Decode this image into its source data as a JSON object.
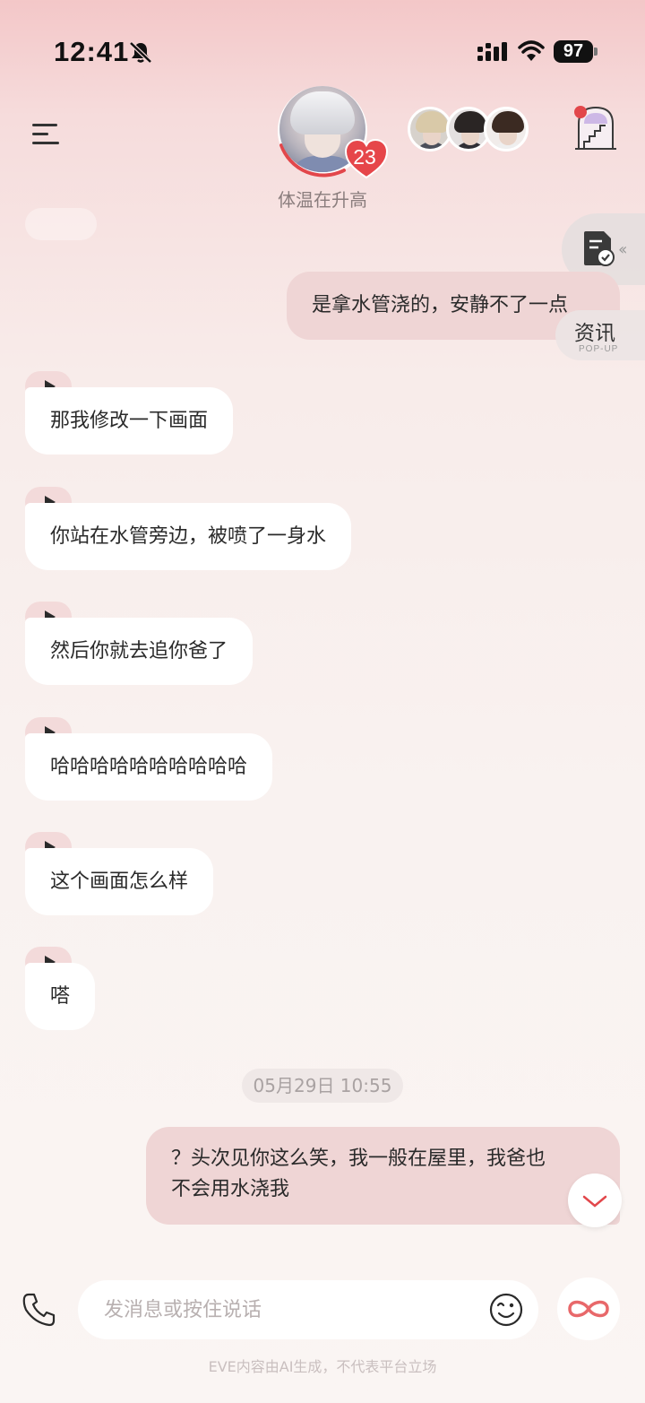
{
  "status_bar": {
    "time": "12:41",
    "battery": "97"
  },
  "header": {
    "affection_level": "23",
    "status_caption": "体温在升高"
  },
  "side_panel": {
    "news_label": "资讯",
    "news_sublabel": "POP-UP"
  },
  "messages": [
    {
      "role": "user",
      "text": "是拿水管浇的，安静不了一点"
    },
    {
      "role": "ai",
      "text": "那我修改一下画面"
    },
    {
      "role": "ai",
      "text": "你站在水管旁边，被喷了一身水"
    },
    {
      "role": "ai",
      "text": "然后你就去追你爸了"
    },
    {
      "role": "ai",
      "text": "哈哈哈哈哈哈哈哈哈哈"
    },
    {
      "role": "ai",
      "text": "这个画面怎么样"
    },
    {
      "role": "ai",
      "text": "嗒"
    },
    {
      "role": "timestamp",
      "text": "05月29日 10:55"
    },
    {
      "role": "user",
      "line1": "？头次见你这么笑，我一般在屋里，我爸也",
      "line2": "不会用水浇我"
    }
  ],
  "composer": {
    "placeholder": "发消息或按住说话"
  },
  "footer": {
    "disclaimer": "EVE内容由AI生成，不代表平台立场"
  },
  "colors": {
    "accent": "#e2474b",
    "user_bubble": "#efd5d5",
    "ai_bubble": "#ffffff"
  },
  "icons": [
    "bell-off-icon",
    "signal-icon",
    "wifi-icon",
    "menu-icon",
    "heart-icon",
    "castle-icon",
    "document-check-icon",
    "play-icon",
    "chevron-down-icon",
    "phone-icon",
    "emoji-icon",
    "infinity-icon"
  ]
}
